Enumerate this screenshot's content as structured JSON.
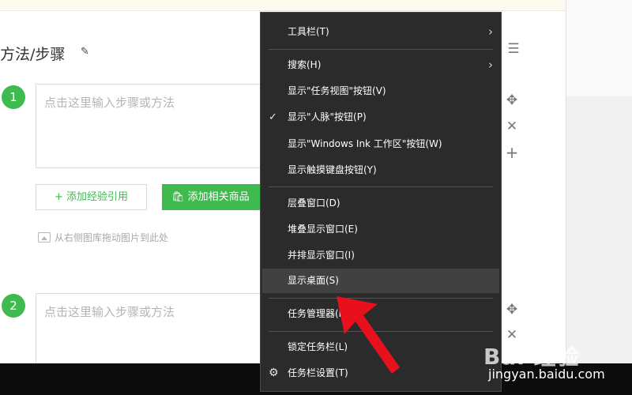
{
  "editor": {
    "section_title": "方法/步骤",
    "steps": [
      {
        "number": "1",
        "placeholder": "点击这里输入步骤或方法"
      },
      {
        "number": "2",
        "placeholder": "点击这里输入步骤或方法"
      }
    ],
    "add_reference_label": "+ 添加经验引用",
    "add_goods_label": "添加相关商品",
    "drag_hint": "从右侧图库拖动图片到此处",
    "icons": [
      "edit-icon",
      "list-icon",
      "move-icon",
      "close-icon",
      "plus-icon",
      "image-icon",
      "shopping-bag-icon"
    ]
  },
  "context_menu": {
    "items": [
      {
        "label": "工具栏(T)",
        "submenu": true
      },
      {
        "label": "搜索(H)",
        "submenu": true
      },
      {
        "label": "显示\"任务视图\"按钮(V)"
      },
      {
        "label": "显示\"人脉\"按钮(P)",
        "checked": true
      },
      {
        "label": "显示\"Windows Ink 工作区\"按钮(W)"
      },
      {
        "label": "显示触摸键盘按钮(Y)"
      },
      {
        "label": "层叠窗口(D)"
      },
      {
        "label": "堆叠显示窗口(E)"
      },
      {
        "label": "并排显示窗口(I)"
      },
      {
        "label": "显示桌面(S)",
        "hovered": true
      },
      {
        "label": "任务管理器(K)"
      },
      {
        "label": "锁定任务栏(L)"
      },
      {
        "label": "任务栏设置(T)",
        "icon": "gear-icon"
      }
    ]
  },
  "watermark": {
    "logo": "Bai 经验",
    "url": "jingyan.baidu.com"
  },
  "colors": {
    "accent_green": "#3fba4e",
    "menu_bg": "#2b2b2b",
    "menu_hover": "#414141",
    "arrow_red": "#e8101c",
    "taskbar": "#0c0c0c"
  }
}
